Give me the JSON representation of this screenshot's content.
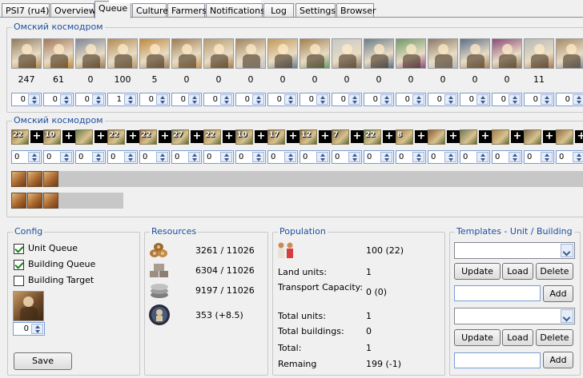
{
  "tabs": [
    "PSI7 (ru4)",
    "Overview",
    "Queue",
    "Culture",
    "Farmers",
    "Notifications",
    "Log",
    "Settings",
    "Browser"
  ],
  "units_group": {
    "title": "Омский космодром",
    "counts": [
      "247",
      "61",
      "0",
      "100",
      "5",
      "0",
      "0",
      "0",
      "0",
      "0",
      "0",
      "0",
      "0",
      "0",
      "0",
      "0",
      "11",
      ""
    ],
    "inputs": [
      "0",
      "0",
      "0",
      "1",
      "0",
      "0",
      "0",
      "0",
      "0",
      "0",
      "0",
      "0",
      "0",
      "0",
      "0",
      "0",
      "0",
      "0"
    ]
  },
  "buildings_group": {
    "title": "Омский космодром",
    "levels": [
      "22",
      "10",
      "",
      "22",
      "22",
      "27",
      "22",
      "10",
      "17",
      "12",
      "7",
      "22",
      "8",
      "",
      "",
      "",
      "",
      ""
    ],
    "plus": "+",
    "inputs": [
      "0",
      "0",
      "0",
      "0",
      "0",
      "0",
      "0",
      "0",
      "0",
      "0",
      "0",
      "0",
      "0",
      "0",
      "0",
      "0",
      "0",
      "0"
    ]
  },
  "config": {
    "title": "Config",
    "unit_queue": "Unit Queue",
    "building_queue": "Building Queue",
    "building_target": "Building Target",
    "hero_input": "0",
    "save": "Save"
  },
  "resources": {
    "title": "Resources",
    "wood": "3261 / 11026",
    "stone": "6304 / 11026",
    "silver": "9197 / 11026",
    "favor": "353 (+8.5)"
  },
  "population": {
    "title": "Population",
    "value": "100 (22)",
    "land_units_label": "Land units:",
    "land_units": "1",
    "transport_label": "Transport Capacity:",
    "transport": "0 (0)",
    "total_units_label": "Total units:",
    "total_units": "1",
    "total_buildings_label": "Total buildings:",
    "total_buildings": "0",
    "total_label": "Total:",
    "total": "1",
    "remaining_label": "Remaing",
    "remaining": "199 (-1)"
  },
  "templates": {
    "title": "Templates - Unit / Building",
    "update": "Update",
    "load": "Load",
    "delete": "Delete",
    "add": "Add"
  }
}
